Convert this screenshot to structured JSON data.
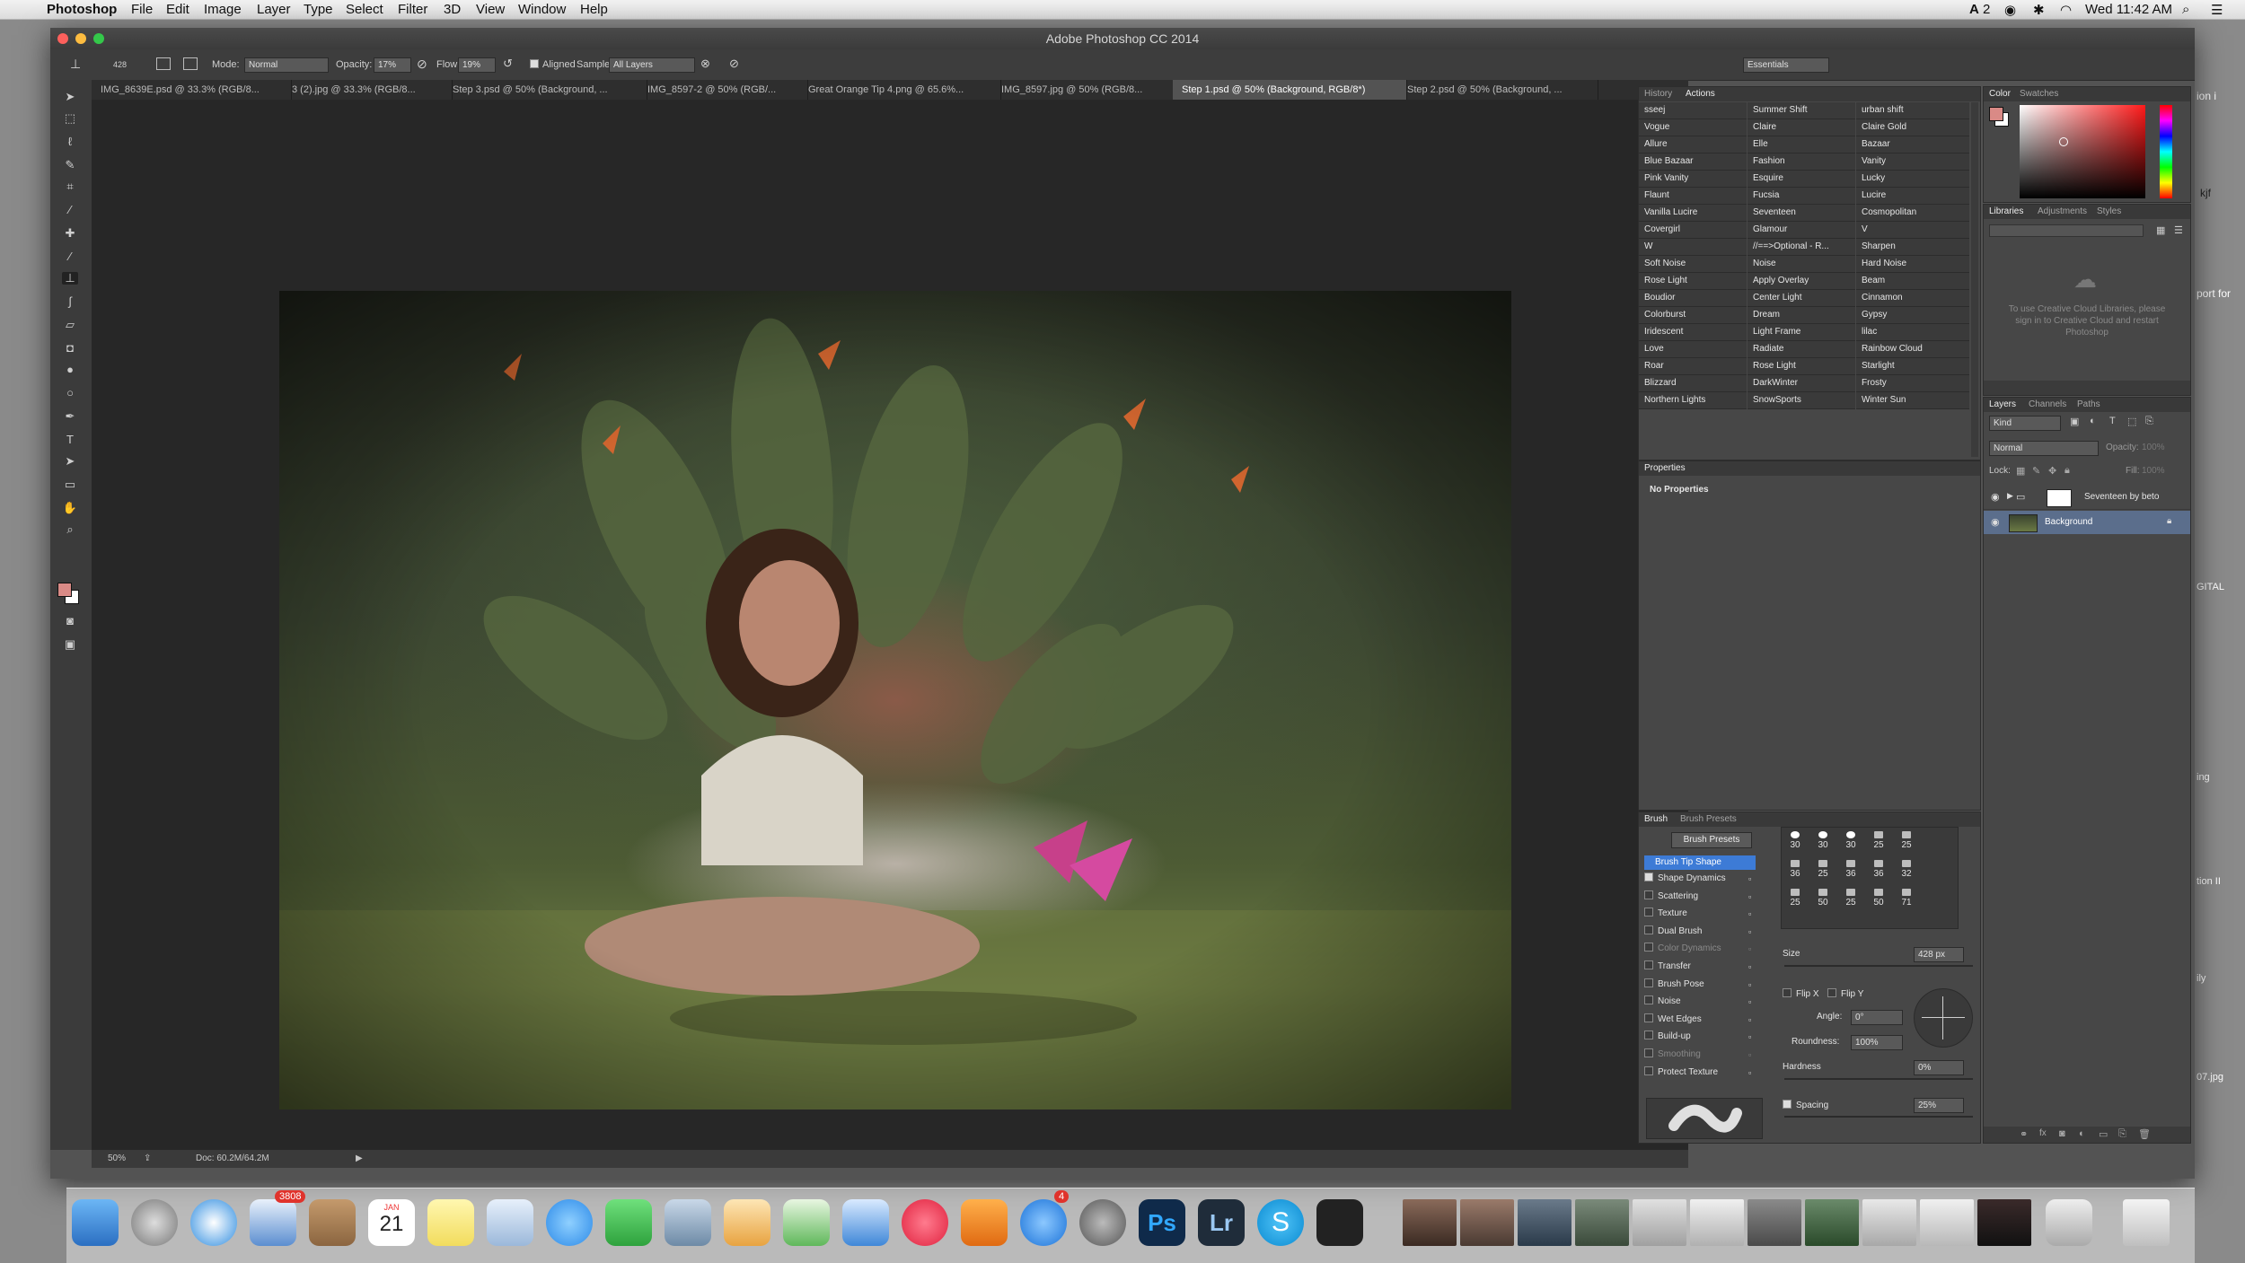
{
  "menubar": {
    "app": "Photoshop",
    "items": [
      "File",
      "Edit",
      "Image",
      "Layer",
      "Type",
      "Select",
      "Filter",
      "3D",
      "View",
      "Window",
      "Help"
    ],
    "status_battery": "2",
    "clock": "Wed 11:42 AM"
  },
  "window": {
    "title": "Adobe Photoshop CC 2014"
  },
  "options": {
    "brush_size": "428",
    "mode_label": "Mode:",
    "mode_value": "Normal",
    "opacity_label": "Opacity:",
    "opacity_value": "17%",
    "flow_label": "Flow:",
    "flow_value": "19%",
    "aligned_label": "Aligned",
    "sample_label": "Sample:",
    "sample_value": "All Layers",
    "workspace": "Essentials"
  },
  "tabs": [
    "IMG_8639E.psd @ 33.3% (RGB/8...",
    "3 (2).jpg @ 33.3% (RGB/8...",
    "Step 3.psd @ 50% (Background, ...",
    "IMG_8597-2 @ 50% (RGB/...",
    "Great Orange Tip 4.png @ 65.6%...",
    "IMG_8597.jpg @ 50% (RGB/8...",
    "Step 1.psd @ 50% (Background, RGB/8*)",
    "Step 2.psd @ 50% (Background, ..."
  ],
  "status": {
    "zoom": "50%",
    "doc": "Doc: 60.2M/64.2M"
  },
  "history_panel": {
    "tabs": [
      "History",
      "Actions"
    ],
    "actions": [
      [
        "sseej",
        "Summer Shift",
        "urban shift"
      ],
      [
        "Vogue",
        "Claire",
        "Claire Gold"
      ],
      [
        "Allure",
        "Elle",
        "Bazaar"
      ],
      [
        "Blue Bazaar",
        "Fashion",
        "Vanity"
      ],
      [
        "Pink Vanity",
        "Esquire",
        "Lucky"
      ],
      [
        "Flaunt",
        "Fucsia",
        "Lucire"
      ],
      [
        "Vanilla Lucire",
        "Seventeen",
        "Cosmopolitan"
      ],
      [
        "Covergirl",
        "Glamour",
        "V"
      ],
      [
        "W",
        "//==>Optional - R...",
        "Sharpen"
      ],
      [
        "Soft Noise",
        "Noise",
        "Hard Noise"
      ],
      [
        "Rose Light",
        "Apply Overlay",
        "Beam"
      ],
      [
        "Boudior",
        "Center Light",
        "Cinnamon"
      ],
      [
        "Colorburst",
        "Dream",
        "Gypsy"
      ],
      [
        "Iridescent",
        "Light Frame",
        "lilac"
      ],
      [
        "Love",
        "Radiate",
        "Rainbow Cloud"
      ],
      [
        "Roar",
        "Rose Light",
        "Starlight"
      ],
      [
        "Blizzard",
        "DarkWinter",
        "Frosty"
      ],
      [
        "Northern Lights",
        "SnowSports",
        "Winter Sun"
      ]
    ]
  },
  "properties_panel": {
    "title": "Properties",
    "empty": "No Properties"
  },
  "brush_panel": {
    "tabs": [
      "Brush",
      "Brush Presets"
    ],
    "presets_button": "Brush Presets",
    "tip_shape": "Brush Tip Shape",
    "options": [
      {
        "label": "Shape Dynamics",
        "checked": true
      },
      {
        "label": "Scattering",
        "checked": false
      },
      {
        "label": "Texture",
        "checked": false
      },
      {
        "label": "Dual Brush",
        "checked": false
      },
      {
        "label": "Color Dynamics",
        "checked": false
      },
      {
        "label": "Transfer",
        "checked": false
      },
      {
        "label": "Brush Pose",
        "checked": false
      },
      {
        "label": "Noise",
        "checked": false
      },
      {
        "label": "Wet Edges",
        "checked": false
      },
      {
        "label": "Build-up",
        "checked": false
      },
      {
        "label": "Smoothing",
        "checked": false
      },
      {
        "label": "Protect Texture",
        "checked": false
      }
    ],
    "tip_sizes": [
      [
        "30",
        "30",
        "30",
        "25",
        "25"
      ],
      [
        "36",
        "25",
        "36",
        "36",
        "32"
      ],
      [
        "25",
        "50",
        "25",
        "50",
        "71"
      ]
    ],
    "size_label": "Size",
    "size_value": "428 px",
    "flipx": "Flip X",
    "flipy": "Flip Y",
    "angle_label": "Angle:",
    "angle_value": "0°",
    "roundness_label": "Roundness:",
    "roundness_value": "100%",
    "hardness_label": "Hardness",
    "hardness_value": "0%",
    "spacing_label": "Spacing",
    "spacing_value": "25%"
  },
  "color_panel": {
    "tabs": [
      "Color",
      "Swatches"
    ]
  },
  "libraries_panel": {
    "tabs": [
      "Libraries",
      "Adjustments",
      "Styles"
    ],
    "message": "To use Creative Cloud Libraries, please sign in to Creative Cloud and restart Photoshop"
  },
  "layers_panel": {
    "tabs": [
      "Layers",
      "Channels",
      "Paths"
    ],
    "kind": "Kind",
    "blend": "Normal",
    "opacity_label": "Opacity:",
    "opacity_value": "100%",
    "lock_label": "Lock:",
    "fill_label": "Fill:",
    "fill_value": "100%",
    "layers": [
      "Seventeen by beto",
      "Background"
    ]
  },
  "desktop_labels": [
    "ion i",
    "kjf",
    "port for",
    "GITAL",
    "ing",
    "tion II",
    "ily",
    "07.jpg"
  ],
  "dock": {
    "calendar_month": "JAN",
    "calendar_day": "21",
    "mail_badge": "3808",
    "appstore_badge": "4",
    "ps": "Ps",
    "lr": "Lr"
  },
  "colors": {
    "fg": "#d98a86",
    "bg": "#ffffff",
    "accent": "#3d7bd6"
  }
}
